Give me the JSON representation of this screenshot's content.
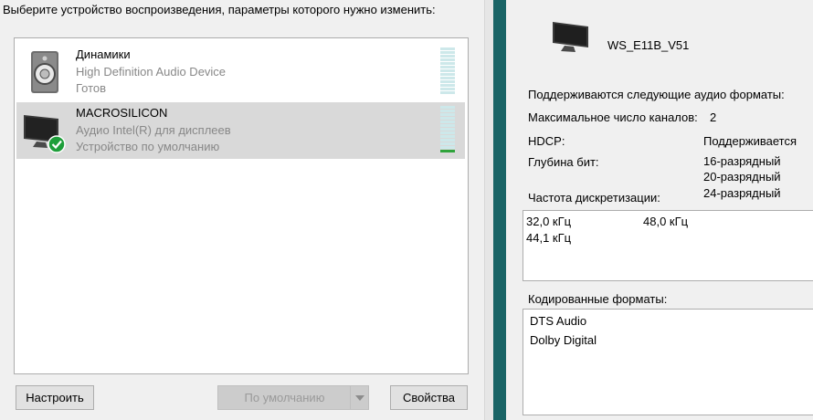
{
  "left": {
    "instruction": "Выберите устройство воспроизведения, параметры которого нужно изменить:",
    "devices": [
      {
        "name": "Динамики",
        "description": "High Definition Audio Device",
        "status": "Готов",
        "icon": "speaker-icon",
        "selected": false,
        "level": 0
      },
      {
        "name": "MACROSILICON",
        "description": "Аудио Intel(R) для дисплеев",
        "status": "Устройство по умолчанию",
        "icon": "monitor-default-icon",
        "selected": true,
        "level": 0.08
      }
    ],
    "buttons": {
      "configure": "Настроить",
      "set_default": "По умолчанию",
      "properties": "Свойства"
    }
  },
  "right": {
    "device_name": "WS_E11B_V51",
    "supported_formats_label": "Поддерживаются следующие аудио форматы:",
    "max_channels_label": "Максимальное число каналов:",
    "max_channels_value": "2",
    "hdcp_label": "HDCP:",
    "hdcp_value": "Поддерживается",
    "bit_depth_label": "Глубина бит:",
    "bit_depths": [
      "16-разрядный",
      "20-разрядный",
      "24-разрядный"
    ],
    "sample_rate_label": "Частота дискретизации:",
    "sample_rates": [
      "32,0 кГц",
      "48,0 кГц",
      "44,1 кГц"
    ],
    "encoded_formats_label": "Кодированные форматы:",
    "encoded_formats": [
      "DTS Audio",
      "Dolby Digital"
    ]
  },
  "colors": {
    "teal_strip": "#1a6466",
    "selected_row": "#d9d9d9",
    "meter_on": "#2fa33b",
    "meter_off": "#cde8ea",
    "check_badge": "#1e9e3a"
  }
}
